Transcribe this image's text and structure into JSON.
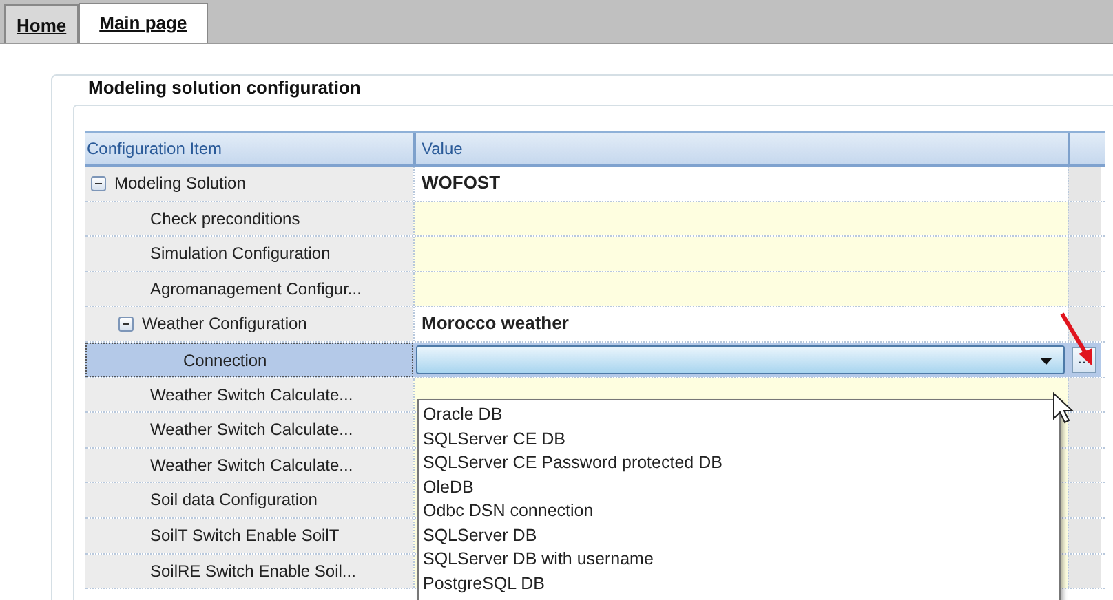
{
  "tabs": [
    {
      "label": "Home",
      "selected": false
    },
    {
      "label": "Main page",
      "selected": true
    }
  ],
  "group_title": "Modeling solution configuration",
  "grid": {
    "columns": [
      "Configuration Item",
      "Value"
    ],
    "rows": [
      {
        "label": "Modeling Solution",
        "kind": "group",
        "value": "WOFOST",
        "expanded": true,
        "selected": false,
        "children": [
          {
            "label": "Check preconditions",
            "kind": "property",
            "selected": false
          },
          {
            "label": "Simulation Configuration",
            "kind": "property",
            "selected": false
          },
          {
            "label": "Agromanagement Configur...",
            "kind": "property",
            "selected": false
          },
          {
            "label": "Weather Configuration",
            "kind": "group",
            "value": "Morocco weather",
            "expanded": true,
            "selected": false,
            "children": [
              {
                "label": "Connection",
                "kind": "combo",
                "selected": true,
                "button": "...",
                "options": [
                  "Oracle DB",
                  "SQLServer CE DB",
                  "SQLServer CE Password protected DB",
                  "OleDB",
                  "Odbc DSN connection",
                  "SQLServer DB",
                  "SQLServer DB with username",
                  "PostgreSQL DB"
                ]
              }
            ]
          },
          {
            "label": "Weather Switch Calculate...",
            "kind": "property",
            "selected": false
          },
          {
            "label": "Weather Switch Calculate...",
            "kind": "property",
            "selected": false
          },
          {
            "label": "Weather Switch Calculate...",
            "kind": "property",
            "selected": false
          },
          {
            "label": "Soil data Configuration",
            "kind": "property",
            "selected": false
          },
          {
            "label": "SoilT Switch Enable SoilT",
            "kind": "property",
            "selected": false
          },
          {
            "label": "SoilRE Switch Enable Soil...",
            "kind": "property",
            "selected": false
          }
        ]
      }
    ]
  }
}
